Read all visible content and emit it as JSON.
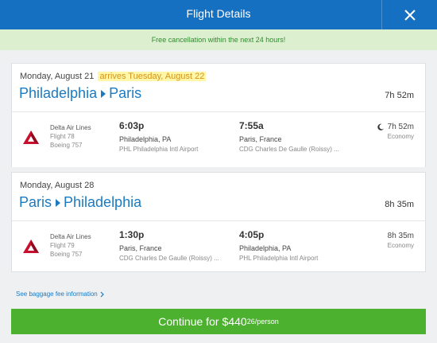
{
  "header": {
    "title": "Flight Details"
  },
  "notice": {
    "text": "Free cancellation within the next 24 hours!"
  },
  "legs": [
    {
      "date": "Monday, August 21",
      "arrives_note": "arrives Tuesday, August 22",
      "origin": "Philadelphia",
      "destination": "Paris",
      "total_duration": "7h 52m",
      "segment": {
        "airline": "Delta Air Lines",
        "flight": "Flight 78",
        "aircraft": "Boeing 757",
        "dep_time": "6:03p",
        "dep_city": "Philadelphia, PA",
        "dep_airport": "PHL Philadelphia Intl Airport",
        "arr_time": "7:55a",
        "arr_city": "Paris, France",
        "arr_airport": "CDG Charles De Gaulle (Roissy) ...",
        "duration": "7h 52m",
        "cabin": "Economy"
      }
    },
    {
      "date": "Monday, August 28",
      "arrives_note": "",
      "origin": "Paris",
      "destination": "Philadelphia",
      "total_duration": "8h 35m",
      "segment": {
        "airline": "Delta Air Lines",
        "flight": "Flight 79",
        "aircraft": "Boeing 757",
        "dep_time": "1:30p",
        "dep_city": "Paris, France",
        "dep_airport": "CDG Charles De Gaulle (Roissy) ...",
        "arr_time": "4:05p",
        "arr_city": "Philadelphia, PA",
        "arr_airport": "PHL Philadelphia Intl Airport",
        "duration": "8h 35m",
        "cabin": "Economy"
      }
    }
  ],
  "baggage": {
    "link_text": "See baggage fee information"
  },
  "continue": {
    "label": "Continue for",
    "price": "$440",
    "cents": "26",
    "per": "/person"
  },
  "icons": {
    "close": "close-icon",
    "moon": "moon-icon",
    "airline_logo": "delta-logo-icon",
    "chevron": "chevron-right-icon"
  },
  "colors": {
    "header": "#1670c1",
    "notice_bg": "#dcf0cf",
    "notice_text": "#2e8b2e",
    "route_blue": "#1a7bc4",
    "continue_green": "#4db130",
    "highlight": "#fff6a8",
    "delta_red": "#c8102e"
  }
}
